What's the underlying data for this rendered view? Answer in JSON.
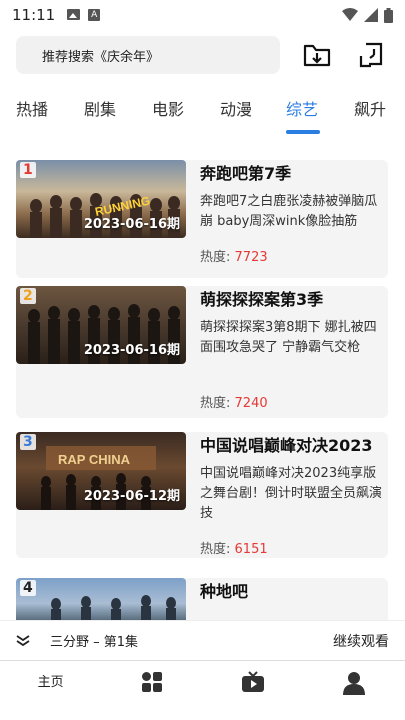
{
  "status_bar": {
    "time": "11:11",
    "a_label": "A"
  },
  "search": {
    "placeholder": "推荐搜索《庆余年》"
  },
  "icons": {
    "download": "download-folder-icon",
    "history": "history-icon"
  },
  "tabs": [
    {
      "label": "热播",
      "active": false
    },
    {
      "label": "剧集",
      "active": false
    },
    {
      "label": "电影",
      "active": false
    },
    {
      "label": "动漫",
      "active": false
    },
    {
      "label": "综艺",
      "active": true
    },
    {
      "label": "飙升",
      "active": false
    }
  ],
  "list": [
    {
      "rank": "1",
      "rank_color": "#e53935",
      "date": "2023-06-16期",
      "title": "奔跑吧第7季",
      "desc": "奔跑吧7之白鹿张凌赫被弹脑瓜崩 baby周深wink像脸抽筋",
      "heat_label": "热度:",
      "heat_value": "7723"
    },
    {
      "rank": "2",
      "rank_color": "#f0a020",
      "date": "2023-06-16期",
      "title": "萌探探探案第3季",
      "desc": "萌探探探案3第8期下 娜扎被四面围攻急哭了 宁静霸气交枪",
      "heat_label": "热度:",
      "heat_value": "7240"
    },
    {
      "rank": "3",
      "rank_color": "#3a7bd5",
      "date": "2023-06-12期",
      "title": "中国说唱巅峰对决2023",
      "desc": "中国说唱巅峰对决2023纯享版之舞台剧！倒计时联盟全员飙演技",
      "heat_label": "热度:",
      "heat_value": "6151"
    },
    {
      "rank": "4",
      "rank_color": "#222222",
      "date": "",
      "title": "种地吧",
      "desc": "",
      "heat_label": "",
      "heat_value": ""
    }
  ],
  "continue": {
    "title": "三分野 – 第1集",
    "action": "继续观看"
  },
  "bottom_nav": [
    {
      "label": "主页",
      "icon": "home"
    },
    {
      "label": "",
      "icon": "apps-icon"
    },
    {
      "label": "",
      "icon": "tv-icon"
    },
    {
      "label": "",
      "icon": "profile-icon"
    }
  ],
  "colors": {
    "accent": "#2a7de1",
    "heat": "#e53935"
  }
}
